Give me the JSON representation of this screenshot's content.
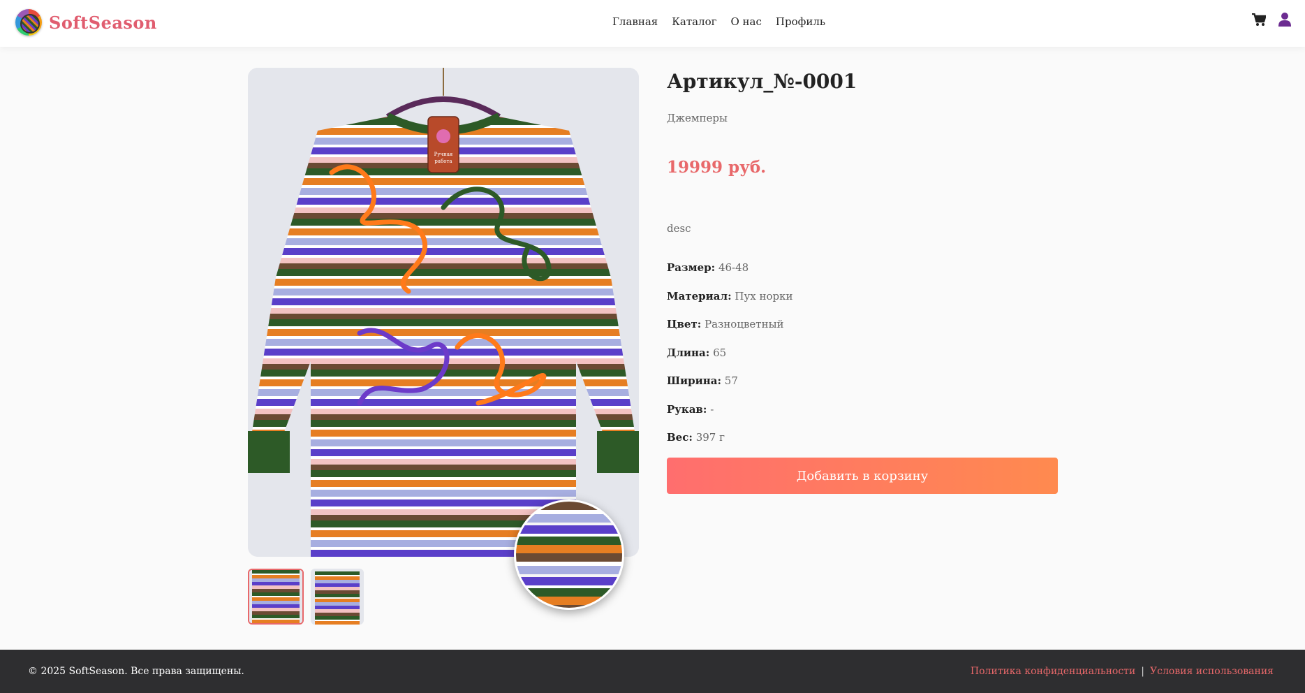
{
  "header": {
    "brand": "SoftSeason",
    "nav": [
      {
        "label": "Главная"
      },
      {
        "label": "Каталог"
      },
      {
        "label": "О нас"
      },
      {
        "label": "Профиль"
      }
    ],
    "icons": [
      "cart-icon",
      "user-icon"
    ]
  },
  "gallery": {
    "hang_tag_text": "Ручная работа",
    "thumbnail_count": 2,
    "active_thumbnail": 1
  },
  "product": {
    "title": "Артикул_№-0001",
    "category": "Джемперы",
    "price": "19999 руб.",
    "description": "desc",
    "specs": [
      {
        "label": "Размер:",
        "value": "46-48"
      },
      {
        "label": "Материал:",
        "value": "Пух норки"
      },
      {
        "label": "Цвет:",
        "value": "Разноцветный"
      },
      {
        "label": "Длина:",
        "value": "65"
      },
      {
        "label": "Ширина:",
        "value": "57"
      },
      {
        "label": "Рукав:",
        "value": "-"
      },
      {
        "label": "Вес:",
        "value": "397 г"
      }
    ],
    "add_to_cart_label": "Добавить в корзину"
  },
  "footer": {
    "copyright": "© 2025 SoftSeason. Все права защищены.",
    "privacy_label": "Политика конфиденциальности",
    "separator": "|",
    "terms_label": "Условия использования"
  },
  "colors": {
    "accent": "#e8686a",
    "button_gradient_start": "#ff6e6e",
    "button_gradient_end": "#ff8a4f",
    "user_icon": "#6c2c91",
    "footer_bg": "#2e2e30"
  }
}
